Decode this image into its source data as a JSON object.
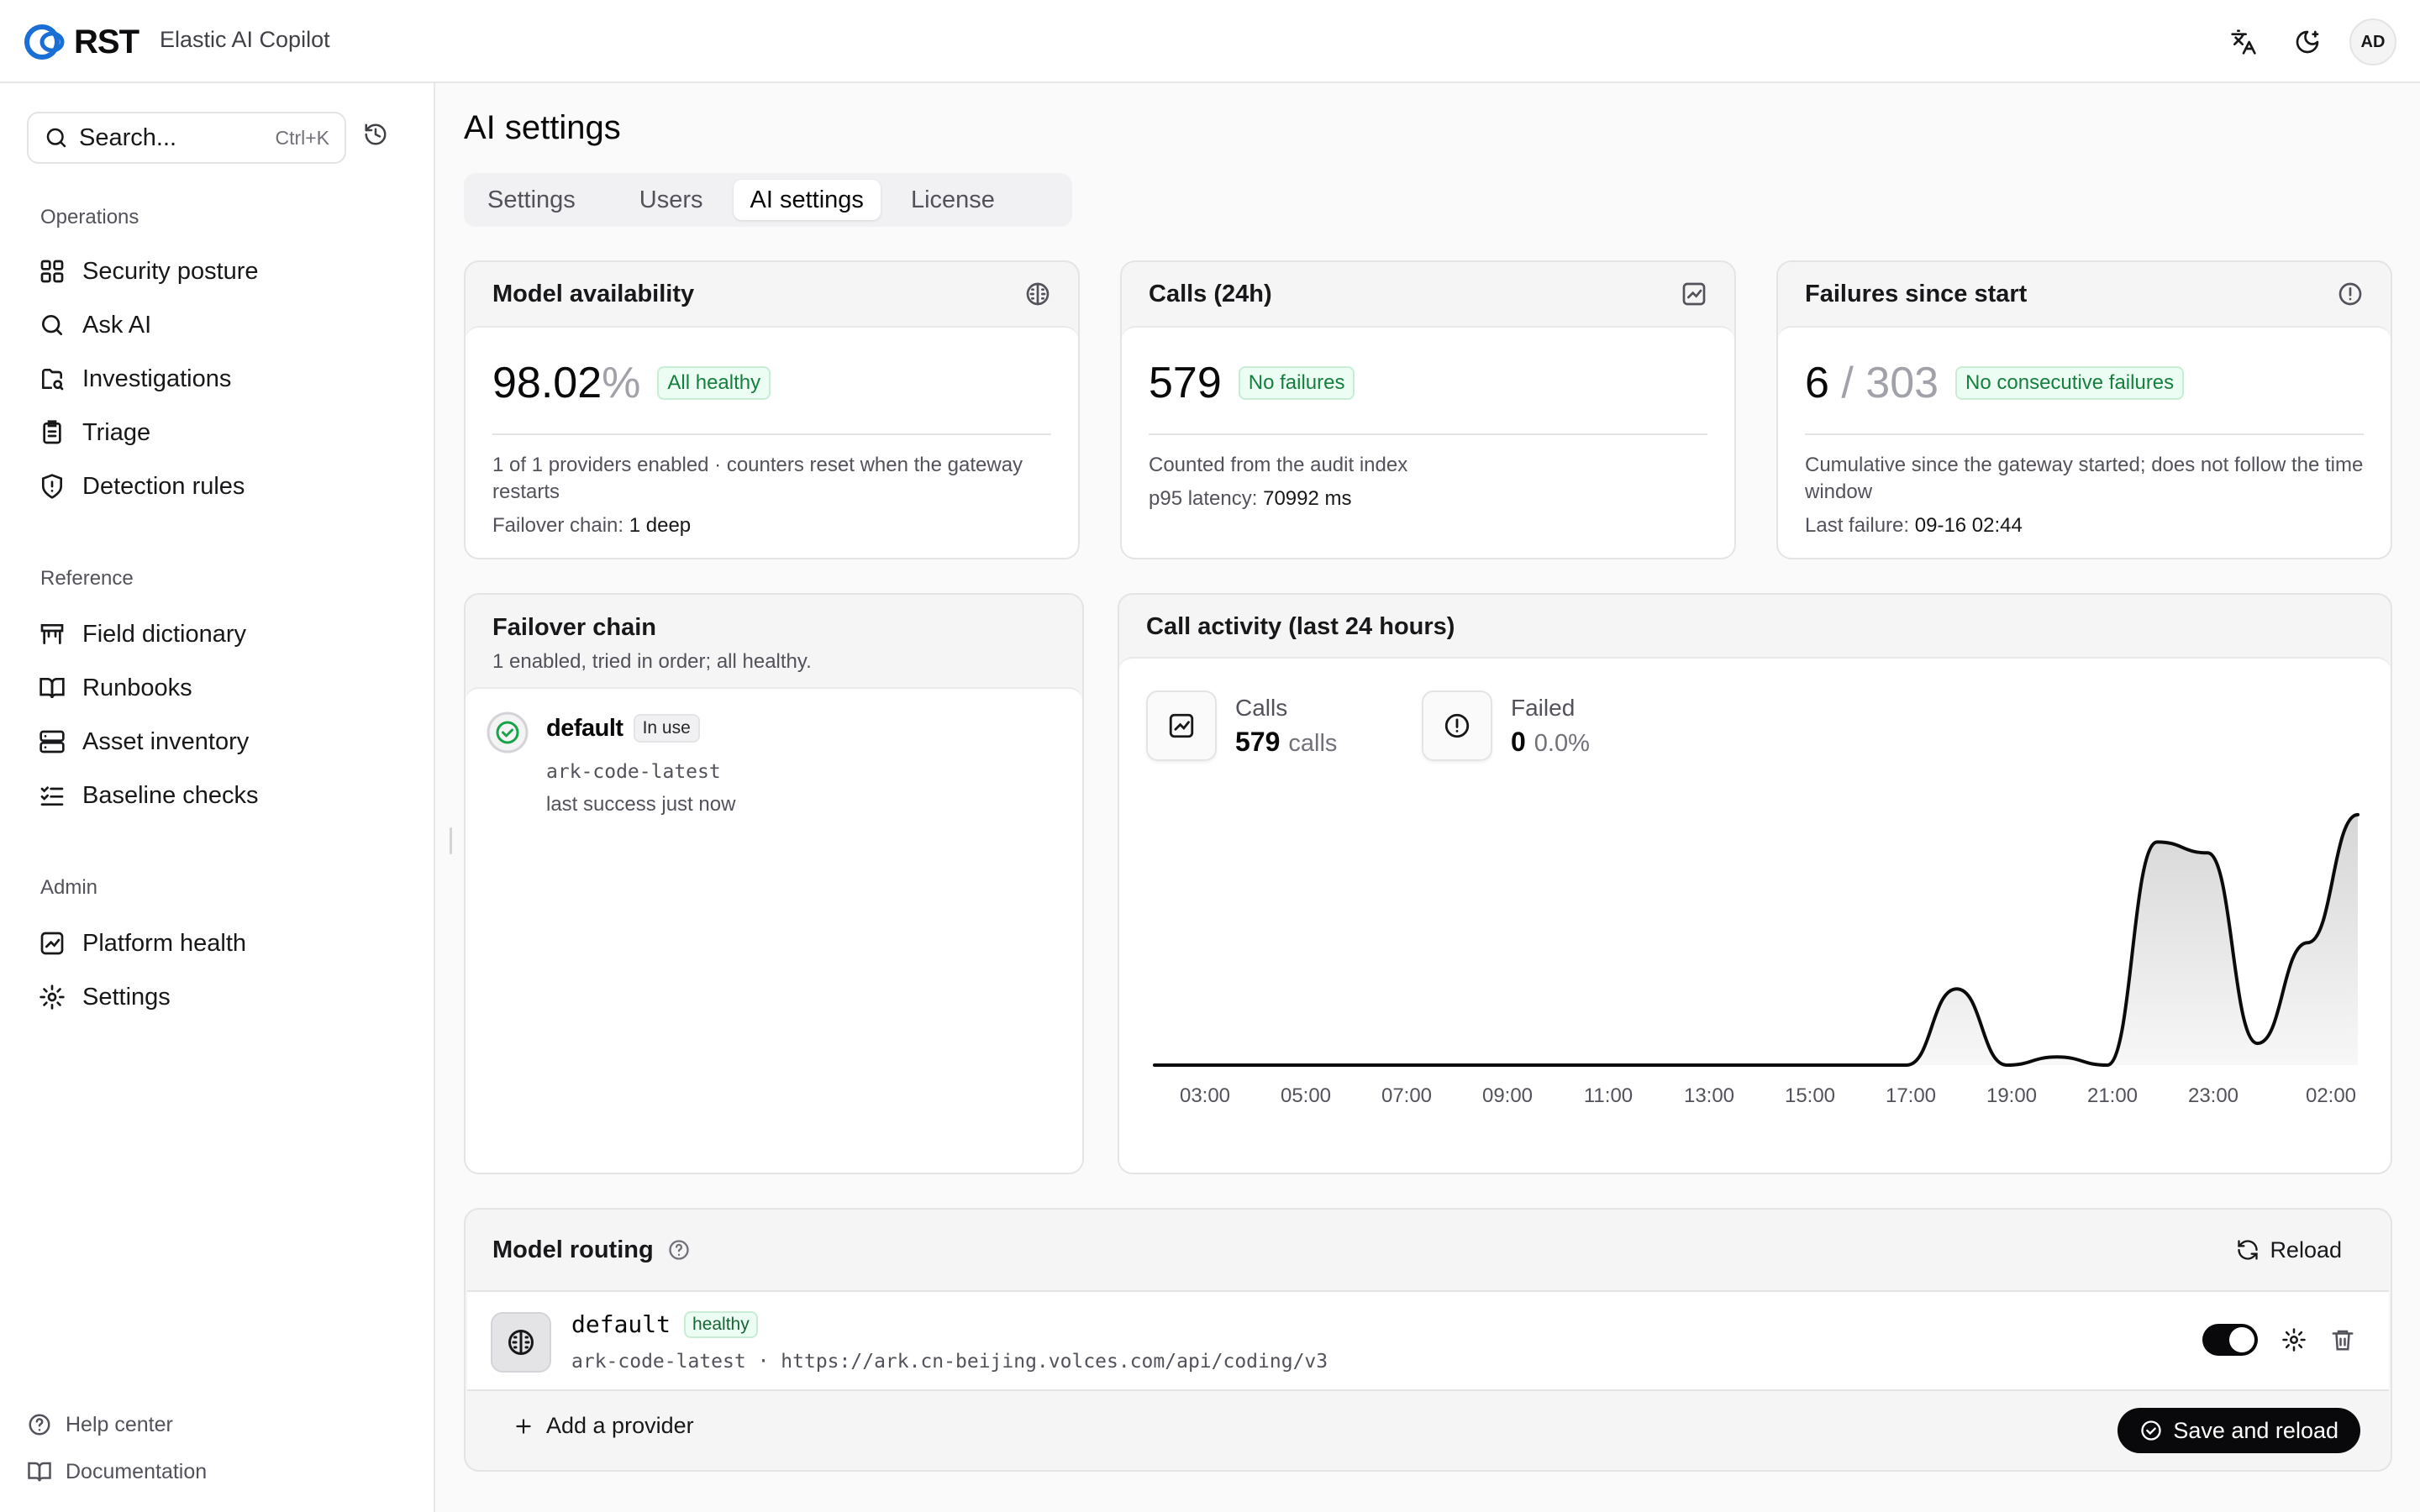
{
  "app": {
    "brand": "RST",
    "name": "Elastic AI Copilot",
    "user_initials": "AD"
  },
  "search": {
    "placeholder": "Search...",
    "shortcut": "Ctrl+K"
  },
  "sidebar": {
    "groups": [
      {
        "label": "Operations",
        "items": [
          {
            "label": "Security posture",
            "icon": "grid-icon"
          },
          {
            "label": "Ask AI",
            "icon": "search-icon"
          },
          {
            "label": "Investigations",
            "icon": "case-icon"
          },
          {
            "label": "Triage",
            "icon": "clipboard-icon"
          },
          {
            "label": "Detection rules",
            "icon": "shield-alert-icon"
          }
        ]
      },
      {
        "label": "Reference",
        "items": [
          {
            "label": "Field dictionary",
            "icon": "table-icon"
          },
          {
            "label": "Runbooks",
            "icon": "book-open-icon"
          },
          {
            "label": "Asset inventory",
            "icon": "server-icon"
          },
          {
            "label": "Baseline checks",
            "icon": "list-checks-icon"
          }
        ]
      },
      {
        "label": "Admin",
        "items": [
          {
            "label": "Platform health",
            "icon": "chart-icon"
          },
          {
            "label": "Settings",
            "icon": "gear-icon"
          }
        ]
      }
    ],
    "footer": [
      {
        "label": "Help center",
        "icon": "help-icon"
      },
      {
        "label": "Documentation",
        "icon": "book-icon"
      }
    ]
  },
  "page": {
    "title": "AI settings",
    "tabs": [
      {
        "label": "Settings",
        "active": false
      },
      {
        "label": "Users",
        "active": false
      },
      {
        "label": "AI settings",
        "active": true
      },
      {
        "label": "License",
        "active": false
      }
    ]
  },
  "availability": {
    "title": "Model availability",
    "value": "98.02",
    "unit": "%",
    "badge": "All healthy",
    "desc": "1 of 1 providers enabled · counters reset when the gateway restarts",
    "chain_label": "Failover chain:",
    "chain_value": "1 deep"
  },
  "calls": {
    "title": "Calls (24h)",
    "value": "579",
    "badge": "No failures",
    "desc": "Counted from the audit index",
    "latency_label": "p95 latency:",
    "latency_value": "70992 ms"
  },
  "failures": {
    "title": "Failures since start",
    "value": "6",
    "total": "/ 303",
    "badge": "No consecutive failures",
    "desc": "Cumulative since the gateway started; does not follow the time window",
    "last_label": "Last failure:",
    "last_value": "09-16 02:44"
  },
  "failover": {
    "title": "Failover chain",
    "subtitle": "1 enabled, tried in order; all healthy.",
    "entry": {
      "name": "default",
      "badge": "In use",
      "model": "ark-code-latest",
      "status": "last success just now"
    }
  },
  "activity": {
    "title": "Call activity (last 24 hours)",
    "calls_label": "Calls",
    "calls_value": "579",
    "calls_unit": "calls",
    "failed_label": "Failed",
    "failed_value": "0",
    "failed_pct": "0.0%"
  },
  "chart_data": {
    "type": "area",
    "x_ticks": [
      "03:00",
      "05:00",
      "07:00",
      "09:00",
      "11:00",
      "13:00",
      "15:00",
      "17:00",
      "19:00",
      "21:00",
      "23:00",
      "02:00"
    ],
    "x": [
      0,
      1,
      2,
      3,
      4,
      5,
      6,
      7,
      8,
      9,
      10,
      11,
      12,
      13,
      14,
      15,
      16,
      17,
      18,
      19,
      20,
      21,
      22,
      23,
      24
    ],
    "values": [
      0,
      0,
      0,
      0,
      0,
      0,
      0,
      0,
      0,
      0,
      0,
      0,
      0,
      0,
      0,
      0,
      28,
      0,
      3,
      0,
      82,
      78,
      8,
      45,
      92
    ],
    "ylim": [
      0,
      100
    ],
    "grid": false,
    "color": "#0b0b0d"
  },
  "routing": {
    "title": "Model routing",
    "reload": "Reload",
    "provider": {
      "name": "default",
      "badge": "healthy",
      "model": "ark-code-latest",
      "sep": "·",
      "endpoint": "https://ark.cn-beijing.volces.com/api/coding/v3",
      "enabled": true
    },
    "add": "Add a provider",
    "save": "Save and reload"
  },
  "colors": {
    "accent": "#1a73e8",
    "healthy_bg": "#ecfdf3",
    "healthy_fg": "#15803d",
    "dark": "#09090b"
  }
}
